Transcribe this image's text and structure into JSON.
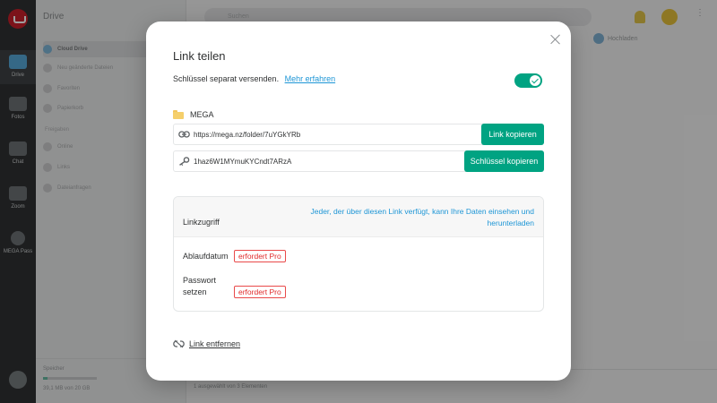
{
  "app": {
    "sidebar_title": "Drive",
    "rail": [
      {
        "label": "Drive"
      },
      {
        "label": "Fotos"
      },
      {
        "label": "Chat"
      },
      {
        "label": "Zoom"
      },
      {
        "label": "MEGA Pass"
      }
    ],
    "side_items": [
      {
        "label": "Cloud Drive"
      },
      {
        "label": "Neu geänderte Dateien"
      },
      {
        "label": "Favoriten"
      },
      {
        "label": "Papierkorb"
      }
    ],
    "side_group": "Freigaben",
    "side_group_items": [
      {
        "label": "Online"
      },
      {
        "label": "Links"
      },
      {
        "label": "Dateianfragen"
      }
    ],
    "storage_title": "Speicher",
    "storage_text": "39,1 MB von 20 GB",
    "search_placeholder": "Suchen",
    "upload_label": "Hochladen",
    "status_text": "1 ausgewählt von 3 Elementen"
  },
  "dialog": {
    "title": "Link teilen",
    "separate_key_text": "Schlüssel separat versenden.",
    "learn_more": "Mehr erfahren",
    "toggle_on": true,
    "folder_name": "MEGA",
    "link_url": "https://mega.nz/folder/7uYGkYRb",
    "copy_link_button": "Link kopieren",
    "key_value": "1haz6W1MYmuKYCndt7ARzA",
    "copy_key_button": "Schlüssel kopieren",
    "access": {
      "label": "Linkzugriff",
      "description": "Jeder, der über diesen Link verfügt, kann Ihre Daten einsehen und herunterladen"
    },
    "options": [
      {
        "label": "Ablaufdatum",
        "badge": "erfordert Pro"
      },
      {
        "label": "Passwort setzen",
        "badge": "erfordert Pro"
      }
    ],
    "remove_link": "Link entfernen"
  },
  "colors": {
    "accent_green": "#00a382",
    "link_blue": "#1e96d6",
    "pro_red": "#e02a2a",
    "folder_yellow": "#f5cf6b"
  }
}
